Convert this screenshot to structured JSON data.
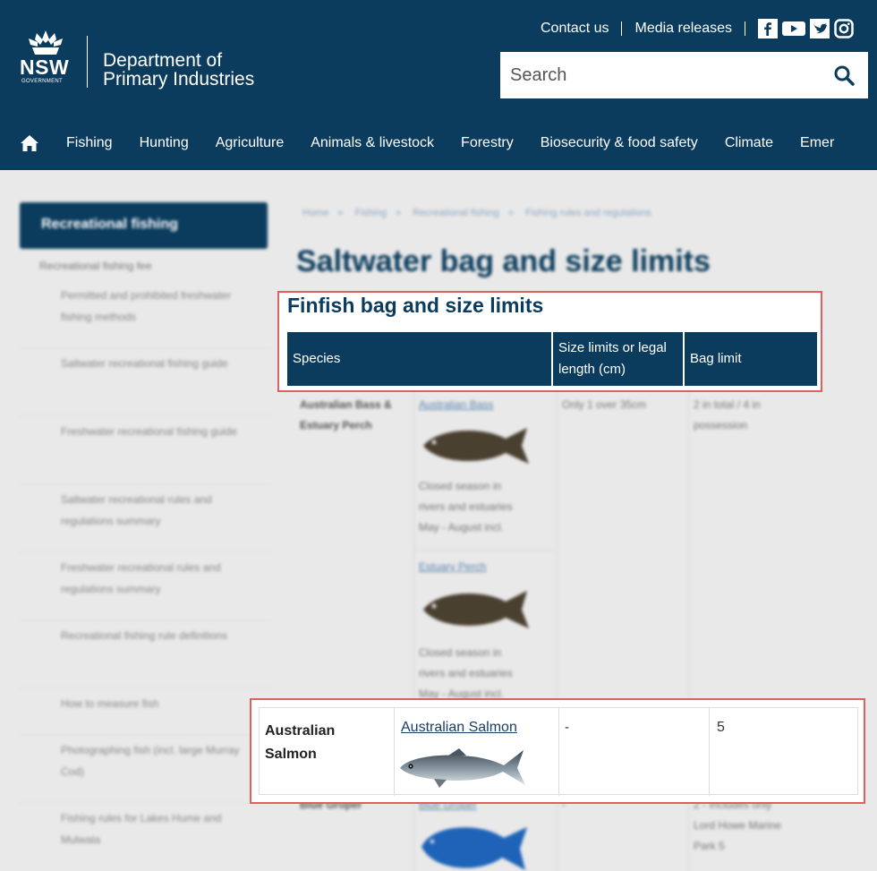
{
  "header": {
    "logo": {
      "wordmark": "NSW",
      "subtext": "GOVERNMENT"
    },
    "department_line1": "Department of",
    "department_line2": "Primary Industries",
    "toplinks": {
      "contact": "Contact us",
      "media": "Media releases"
    },
    "social_icons": [
      "facebook-icon",
      "youtube-icon",
      "twitter-icon",
      "instagram-icon"
    ],
    "search": {
      "placeholder": "Search"
    },
    "nav": [
      "Fishing",
      "Hunting",
      "Agriculture",
      "Animals & livestock",
      "Forestry",
      "Biosecurity & food safety",
      "Climate",
      "Emer"
    ]
  },
  "sidebar": {
    "active": "Recreational fishing",
    "top_item": "Recreational fishing fee",
    "items": [
      "Permitted and prohibited freshwater fishing methods",
      "Saltwater recreational fishing guide",
      "Freshwater recreational fishing guide",
      "Saltwater recreational rules and regulations summary",
      "Freshwater recreational rules and regulations summary",
      "Recreational fishing rule definitions",
      "How to measure fish",
      "Photographing fish (incl. large Murray Cod)",
      "Fishing rules for Lakes Hume and Mulwala"
    ]
  },
  "breadcrumb": [
    "Home",
    "Fishing",
    "Recreational fishing",
    "Fishing rules and regulations"
  ],
  "page_title": "Saltwater bag and size limits",
  "finfish": {
    "heading": "Finfish bag and size limits",
    "columns": {
      "species": "Species",
      "size_line1": "Size limits or legal",
      "size_line2": "length (cm)",
      "bag": "Bag limit"
    }
  },
  "background_rows": {
    "bass_species_line1": "Australian Bass &",
    "bass_species_line2": "Estuary Perch",
    "bass_link": "Australian Bass",
    "bass_note": [
      "Closed season in",
      "rivers and estuaries",
      "May - August incl."
    ],
    "bass_size": "Only 1 over 35cm",
    "bass_bag_line1": "2 in total / 4 in",
    "bass_bag_line2": "possession",
    "perch_link": "Estuary Perch",
    "perch_note": [
      "Closed season in",
      "rivers and estuaries",
      "May - August incl."
    ],
    "blue_species": "Blue Groper",
    "blue_link": "Blue Groper",
    "blue_size": "-",
    "blue_bag": [
      "2 - Includes only",
      "Lord Howe Marine",
      "Park 5"
    ]
  },
  "salmon_row": {
    "species_line1": "Australian",
    "species_line2": "Salmon",
    "link": "Australian Salmon",
    "size": "-",
    "bag": "5"
  },
  "colors": {
    "brand_navy": "#0b3c5d",
    "highlight": "#e06060"
  }
}
